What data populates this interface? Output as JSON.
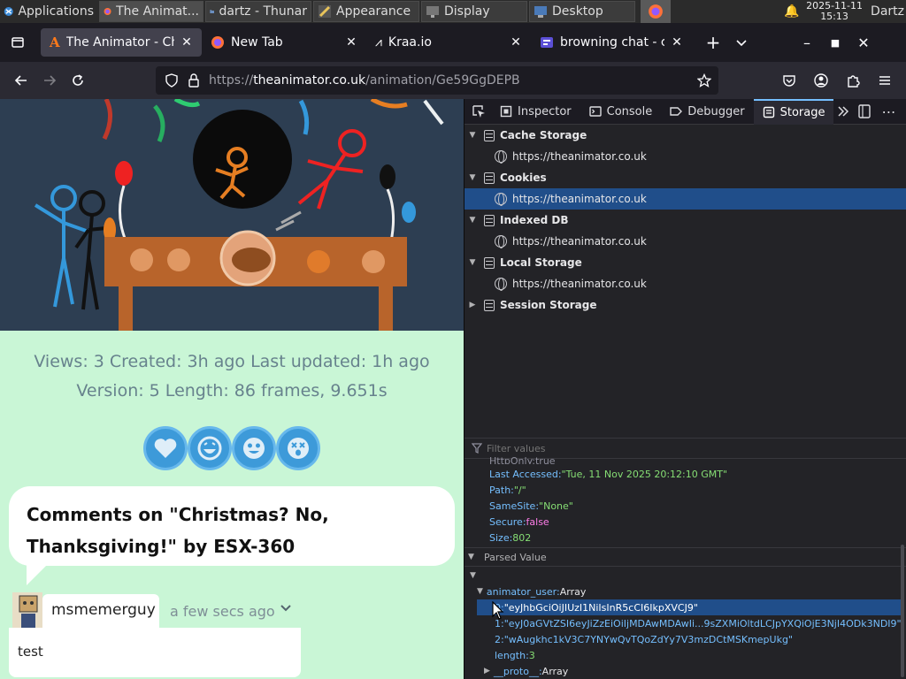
{
  "panel": {
    "applications": "Applications",
    "tasks": [
      {
        "label": "The Animat...",
        "icon": "firefox-icon"
      },
      {
        "label": "dartz - Thunar",
        "icon": "folder-icon"
      },
      {
        "label": "Appearance",
        "icon": "appearance-icon"
      },
      {
        "label": "Display",
        "icon": "display-icon"
      },
      {
        "label": "Desktop",
        "icon": "desktop-icon"
      }
    ],
    "date": "2025-11-11",
    "time": "15:13",
    "user": "Dartz"
  },
  "tabs": [
    {
      "title": "The Animator - Chr",
      "icon": "animator-icon",
      "selected": true
    },
    {
      "title": "New Tab",
      "icon": "firefox-icon",
      "selected": false
    },
    {
      "title": "Kraa.io",
      "icon": "kraa-icon",
      "selected": false
    },
    {
      "title": "browning chat - cha",
      "icon": "chat-icon",
      "selected": false
    }
  ],
  "navbar": {
    "url_prefix": "https://",
    "url_domain": "theanimator.co.uk",
    "url_path": "/animation/Ge59GgDEPB"
  },
  "page": {
    "stats_line1": "Views: 3    Created: 3h ago    Last updated: 1h ago",
    "stats_line2": "Version: 5    Length: 86 frames, 9.651s",
    "comments_title": "Comments on \"Christmas? No, Thanksgiving!\" by ESX-360",
    "comment": {
      "username": "msmemerguy",
      "time": "a few secs ago",
      "body": "test"
    }
  },
  "devtools": {
    "tabs": [
      "Inspector",
      "Console",
      "Debugger",
      "Storage"
    ],
    "selected_tab": "Storage",
    "tree": [
      {
        "label": "Cache Storage",
        "type": "group",
        "expanded": true
      },
      {
        "label": "https://theanimator.co.uk",
        "type": "host"
      },
      {
        "label": "Cookies",
        "type": "group",
        "expanded": true
      },
      {
        "label": "https://theanimator.co.uk",
        "type": "host",
        "selected": true
      },
      {
        "label": "Indexed DB",
        "type": "group",
        "expanded": true
      },
      {
        "label": "https://theanimator.co.uk",
        "type": "host"
      },
      {
        "label": "Local Storage",
        "type": "group",
        "expanded": true
      },
      {
        "label": "https://theanimator.co.uk",
        "type": "host"
      },
      {
        "label": "Session Storage",
        "type": "group",
        "expanded": false
      }
    ],
    "filter_placeholder": "Filter values",
    "details": {
      "partial": "HttpOnly:true",
      "last_accessed_key": "Last Accessed:",
      "last_accessed_val": "\"Tue, 11 Nov 2025 20:12:10 GMT\"",
      "path_key": "Path:",
      "path_val": "\"/\"",
      "samesite_key": "SameSite:",
      "samesite_val": "\"None\"",
      "secure_key": "Secure:",
      "secure_val": "false",
      "size_key": "Size:",
      "size_val": "802"
    },
    "parsed_value_label": "Parsed Value",
    "parsed": {
      "array_key": "animator_user:",
      "array_type": "Array",
      "item0_key": "0:",
      "item0_val": "\"eyJhbGciOiJIUzI1NiIsInR5cCI6IkpXVCJ9\"",
      "item1_key": "1:",
      "item1_val": "\"eyJ0aGVtZSI6eyJiZzEiOiIjMDAwMDAwIi...9sZXMiOltdLCJpYXQiOjE3NjI4ODk3NDI9\"",
      "item2_key": "2:",
      "item2_val": "\"wAugkhc1kV3C7YNYwQvTQoZdYy7V3mzDCtMSKmepUkg\"",
      "length_key": "length:",
      "length_val": "3",
      "proto_key": "__proto__:",
      "proto_val": "Array"
    }
  }
}
